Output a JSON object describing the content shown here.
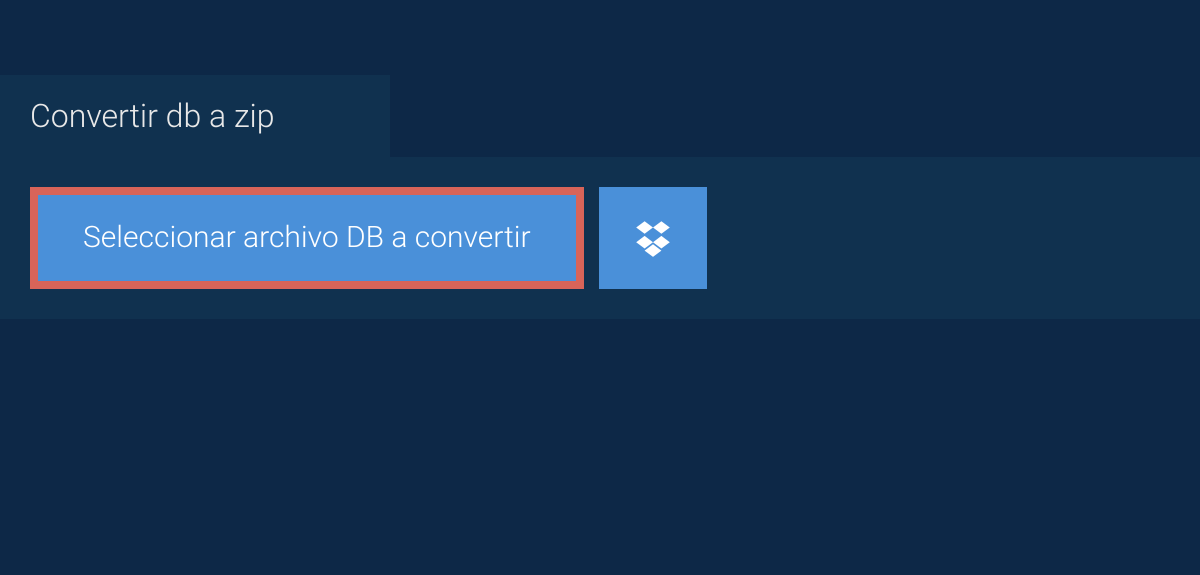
{
  "tab": {
    "title": "Convertir db a zip"
  },
  "actions": {
    "select_file_label": "Seleccionar archivo DB a convertir"
  }
}
